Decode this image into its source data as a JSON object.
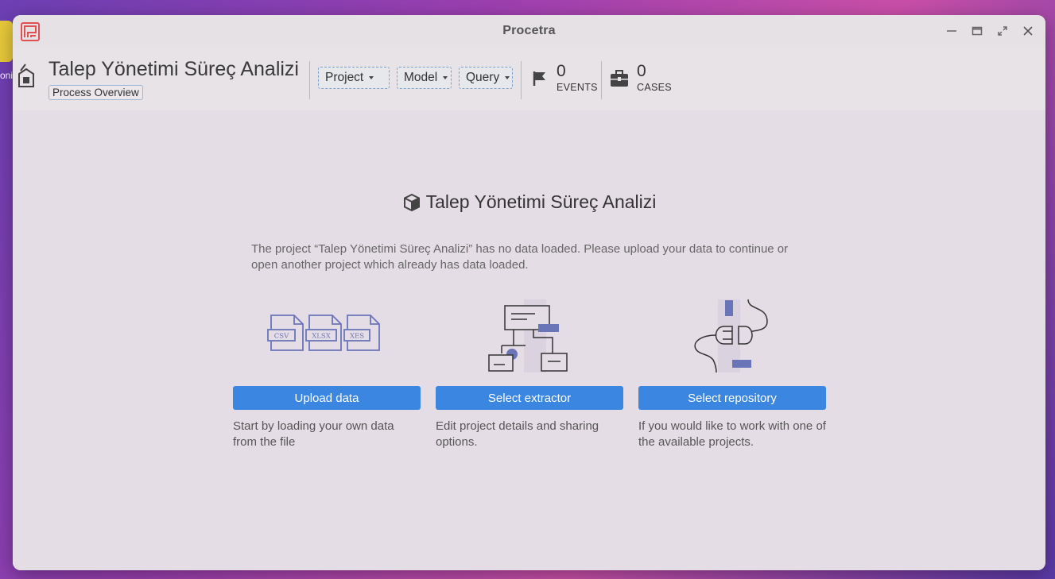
{
  "desktop": {
    "partial_label": "oni"
  },
  "window": {
    "title": "Procetra"
  },
  "toolbar": {
    "project_title": "Talep Yönetimi Süreç Analizi",
    "project_subtitle": "Process Overview",
    "menus": [
      "Project",
      "Model",
      "Query"
    ],
    "events": {
      "count": "0",
      "label": "EVENTS"
    },
    "cases": {
      "count": "0",
      "label": "CASES"
    }
  },
  "main": {
    "heading": "Talep Yönetimi Süreç Analizi",
    "message": "The project “Talep Yönetimi Süreç Analizi” has no data loaded. Please upload your data to continue or open another project which already has data loaded.",
    "cards": [
      {
        "button": "Upload data",
        "description": "Start by loading your own data from the file",
        "file_types": [
          "CSV",
          "XLSX",
          "XES"
        ]
      },
      {
        "button": "Select extractor",
        "description": "Edit project details and sharing options."
      },
      {
        "button": "Select repository",
        "description": "If you would like to work with one of the available projects."
      }
    ]
  },
  "colors": {
    "accent": "#3a86e0",
    "illustration": "#6a75b8",
    "logo": "#e05050"
  }
}
